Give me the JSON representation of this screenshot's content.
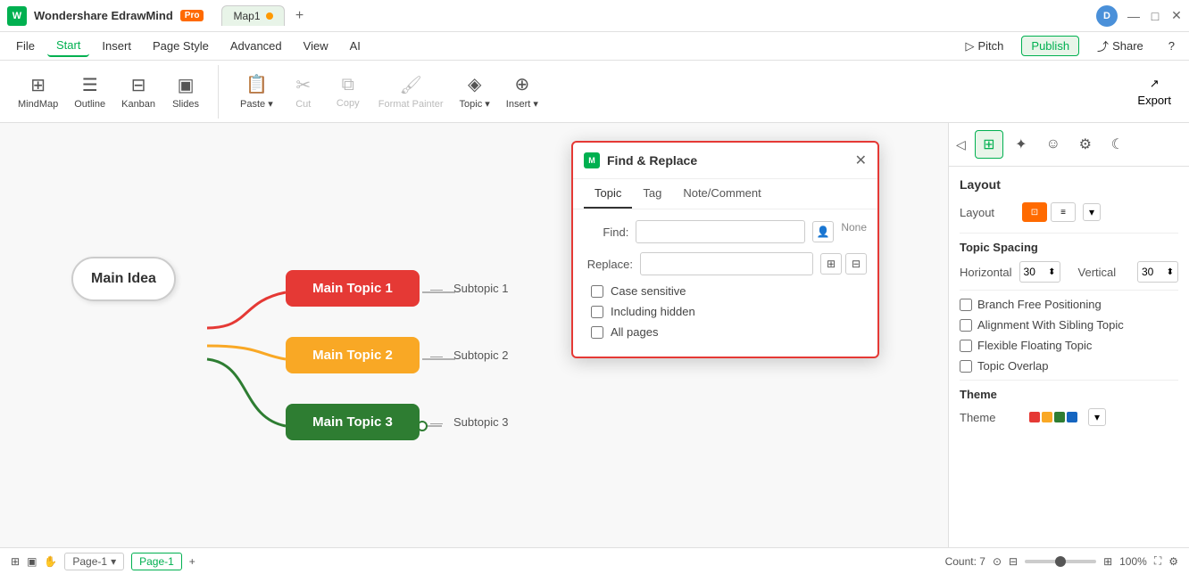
{
  "app": {
    "name": "Wondershare EdrawMind",
    "badge": "Pro",
    "doc_tab": "Map1",
    "avatar": "D"
  },
  "title_bar": {
    "win_minimize": "—",
    "win_restore": "□",
    "win_close": "✕"
  },
  "menu": {
    "items": [
      "File",
      "Start",
      "Insert",
      "Page Style",
      "Advanced",
      "View",
      "AI"
    ],
    "active": "Start",
    "right_items": [
      "Pitch",
      "Publish",
      "Share"
    ]
  },
  "toolbar": {
    "view_buttons": [
      {
        "label": "MindMap",
        "icon": "⊞"
      },
      {
        "label": "Outline",
        "icon": "☰"
      },
      {
        "label": "Kanban",
        "icon": "⊟"
      },
      {
        "label": "Slides",
        "icon": "▣"
      }
    ],
    "actions": [
      {
        "label": "Paste",
        "icon": "📋"
      },
      {
        "label": "Cut",
        "icon": "✂"
      },
      {
        "label": "Copy",
        "icon": "⧉"
      },
      {
        "label": "Format Painter",
        "icon": "🖌"
      },
      {
        "label": "Topic",
        "icon": "◈"
      },
      {
        "label": "Insert",
        "icon": "⊕"
      }
    ],
    "export_label": "Export"
  },
  "mindmap": {
    "central_node": "Main Idea",
    "topics": [
      {
        "label": "Main Topic 1",
        "color": "red",
        "subtopic": "Subtopic 1"
      },
      {
        "label": "Main Topic 2",
        "color": "yellow",
        "subtopic": "Subtopic 2"
      },
      {
        "label": "Main Topic 3",
        "color": "green",
        "subtopic": "Subtopic 3"
      }
    ]
  },
  "dialog": {
    "title": "Find & Replace",
    "tabs": [
      "Topic",
      "Tag",
      "Note/Comment"
    ],
    "active_tab": "Topic",
    "find_label": "Find:",
    "replace_label": "Replace:",
    "none_label": "None",
    "checkboxes": [
      "Case sensitive",
      "Including hidden",
      "All pages"
    ],
    "close_icon": "✕"
  },
  "right_panel": {
    "icons": [
      "layout",
      "ai-star",
      "emoji",
      "security",
      "night-mode"
    ],
    "layout_title": "Layout",
    "layout_label": "Layout",
    "spacing_title": "Topic Spacing",
    "horizontal_label": "Horizontal",
    "horizontal_value": "30",
    "vertical_label": "Vertical",
    "vertical_value": "30",
    "options": [
      {
        "label": "Branch Free Positioning"
      },
      {
        "label": "Alignment With Sibling Topic"
      },
      {
        "label": "Flexible Floating Topic"
      },
      {
        "label": "Topic Overlap"
      }
    ],
    "theme_title": "Theme",
    "theme_label": "Theme"
  },
  "status_bar": {
    "icons_left": [
      "grid",
      "fit",
      "hand"
    ],
    "page_tab": "Page-1",
    "active_page": "Page-1",
    "count_label": "Count: 7",
    "zoom_level": "100%"
  }
}
